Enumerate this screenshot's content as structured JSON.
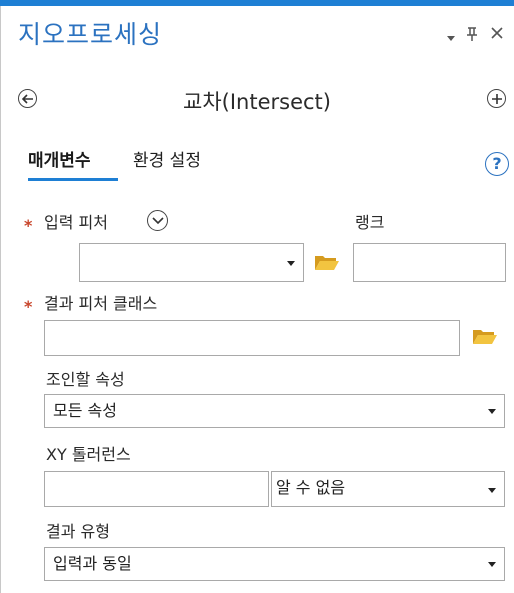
{
  "pane": {
    "title": "지오프로세싱",
    "menu_icon": "dropdown-arrow-icon",
    "pin_icon": "pin-icon",
    "close_icon": "close-icon"
  },
  "tool": {
    "title": "교차(Intersect)",
    "back_icon": "back-arrow-icon",
    "add_icon": "add-icon"
  },
  "tabs": [
    {
      "label": "매개변수",
      "active": true
    },
    {
      "label": "환경 설정",
      "active": false
    }
  ],
  "help_label": "?",
  "fields": {
    "input_features": {
      "label": "입력 피처",
      "required": true,
      "value": "",
      "rank_label": "랭크",
      "rank_value": ""
    },
    "output_feature_class": {
      "label": "결과 피처 클래스",
      "required": true,
      "value": ""
    },
    "join_attributes": {
      "label": "조인할 속성",
      "value": "모든 속성"
    },
    "xy_tolerance": {
      "label": "XY 톨러런스",
      "value": "",
      "unit": "알 수 없음"
    },
    "output_type": {
      "label": "결과 유형",
      "value": "입력과 동일"
    }
  },
  "colors": {
    "accent": "#1e7fd4",
    "title": "#2b72c0",
    "required": "#c8452b",
    "folder": "#e8b32f"
  }
}
